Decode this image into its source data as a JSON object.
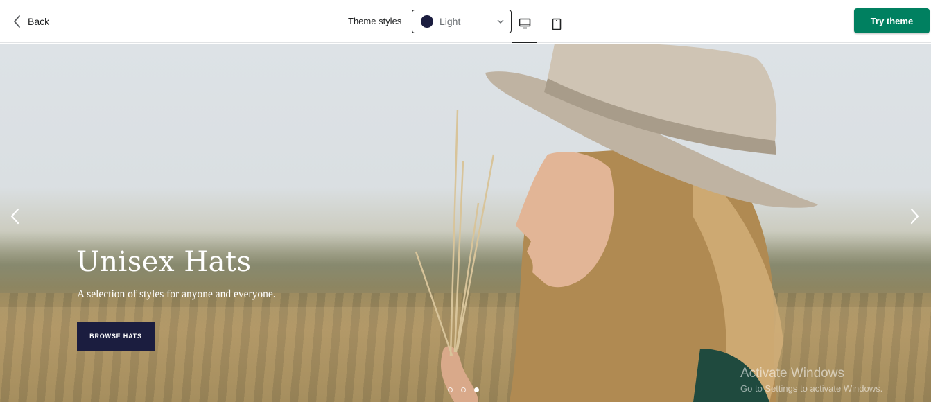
{
  "topbar": {
    "back_label": "Back",
    "theme_styles_label": "Theme styles",
    "theme_style": {
      "value": "Light",
      "swatch_color": "#1b1d3f"
    },
    "view_modes": [
      "desktop",
      "mobile"
    ],
    "active_view": "desktop",
    "try_label": "Try theme",
    "try_color": "#008060"
  },
  "hero": {
    "title": "Unisex Hats",
    "subtitle": "A selection of styles for anyone and everyone.",
    "cta_label": "BROWSE HATS",
    "cta_color": "#1b1d3f",
    "slides_total": 3,
    "active_slide": 3,
    "prev_icon": "chevron-left-icon",
    "next_icon": "chevron-right-icon"
  },
  "overlay": {
    "watermark_title": "Activate Windows",
    "watermark_sub": "Go to Settings to activate Windows."
  }
}
